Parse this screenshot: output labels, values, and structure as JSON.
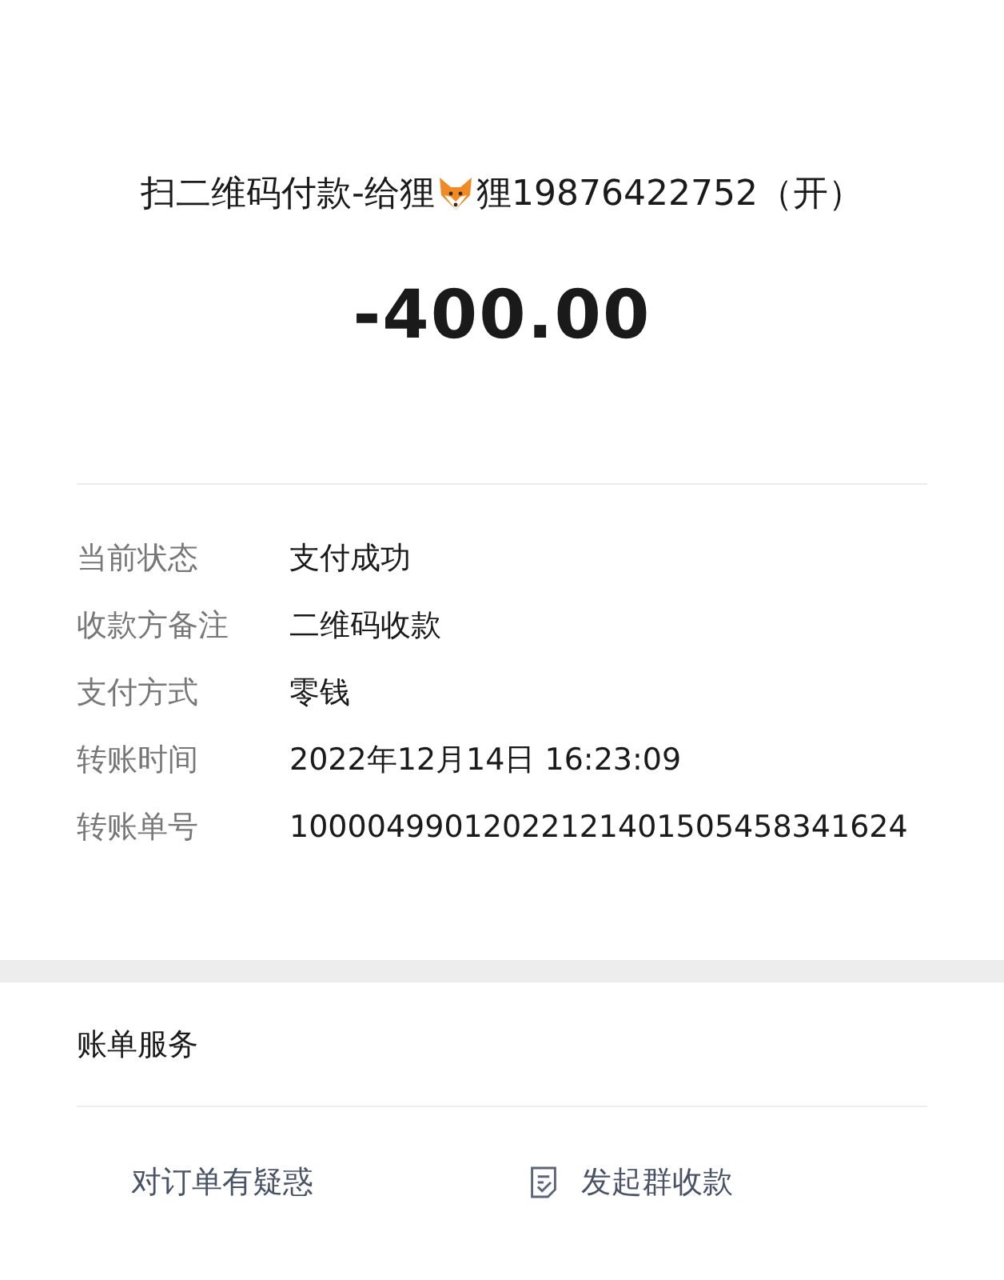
{
  "title_parts": [
    "扫二维码付款-给狸",
    "狸19876422752（开）"
  ],
  "amount": "-400.00",
  "details": [
    {
      "label": "当前状态",
      "value": "支付成功"
    },
    {
      "label": "收款方备注",
      "value": "二维码收款"
    },
    {
      "label": "支付方式",
      "value": "零钱"
    },
    {
      "label": "转账时间",
      "value": "2022年12月14日 16:23:09"
    },
    {
      "label": "转账单号",
      "value": "10000499012022121401505458341624"
    }
  ],
  "services": {
    "title": "账单服务",
    "items": [
      {
        "kind": "text",
        "label": "对订单有疑惑"
      },
      {
        "kind": "icon",
        "label": "发起群收款"
      }
    ]
  }
}
